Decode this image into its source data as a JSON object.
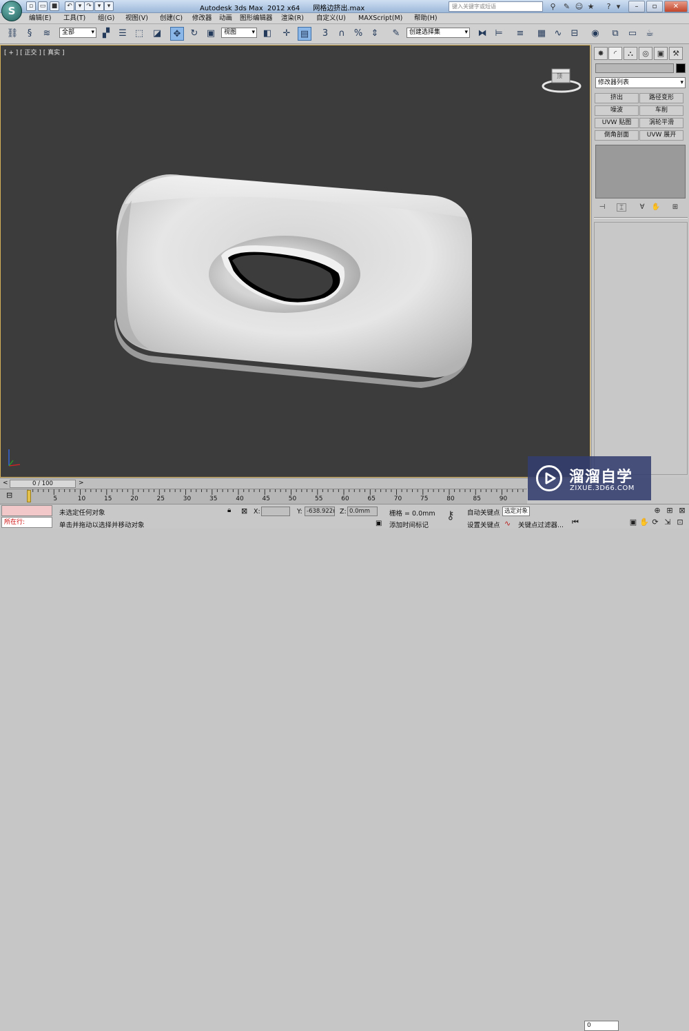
{
  "app": {
    "logo_letter": "S",
    "title": "Autodesk 3ds Max  2012 x64      网格边挤出.max",
    "search_placeholder": "键入关键字或短语"
  },
  "menu": {
    "items": [
      "编辑(E)",
      "工具(T)",
      "组(G)",
      "视图(V)",
      "创建(C)",
      "修改器",
      "动画",
      "图形编辑器",
      "渲染(R)",
      "自定义(U)",
      "MAXScript(M)",
      "帮助(H)"
    ]
  },
  "toolbar": {
    "selection_filter": "全部",
    "ref_coord": "视图",
    "named_selection": "创建选择集",
    "snap_3": "3",
    "snap_percent": "%"
  },
  "viewport": {
    "label": "[ + ] [ 正交 ] [ 真实 ]",
    "viewcube_face": "顶"
  },
  "command_panel": {
    "modifier_list": "修改器列表",
    "modifier_buttons": [
      "挤出",
      "路径变形",
      "噪波",
      "车削",
      "UVW 贴图",
      "涡轮平滑",
      "倒角剖面",
      "UVW 展开"
    ]
  },
  "timeline": {
    "frame_range": "0 / 100",
    "prev": "<",
    "next": ">",
    "ticks": [
      "5",
      "10",
      "15",
      "20",
      "25",
      "30",
      "35",
      "40",
      "45",
      "50",
      "55",
      "60",
      "65",
      "70",
      "75",
      "80",
      "85",
      "90"
    ]
  },
  "status": {
    "running_label": "所在行:",
    "selection_status": "未选定任何对象",
    "prompt": "单击并拖动以选择并移动对象",
    "x_label": "X:",
    "x_value": "",
    "y_label": "Y:",
    "y_value": "-638.922m",
    "z_label": "Z:",
    "z_value": "0.0mm",
    "grid": "栅格 = 0.0mm",
    "add_time_tag": "添加时间标记",
    "auto_key": "自动关键点",
    "selected_objects": "选定对象",
    "set_key": "设置关键点",
    "key_filters": "关键点过滤器...",
    "current_frame": "0"
  },
  "watermark": {
    "brand_cn": "溜溜自学",
    "url": "ZIXUE.3D66.COM"
  },
  "colors": {
    "viewport_bg": "#3c3c3c",
    "active_border": "#d6b15a",
    "watermark_bg": "#323e6e"
  }
}
